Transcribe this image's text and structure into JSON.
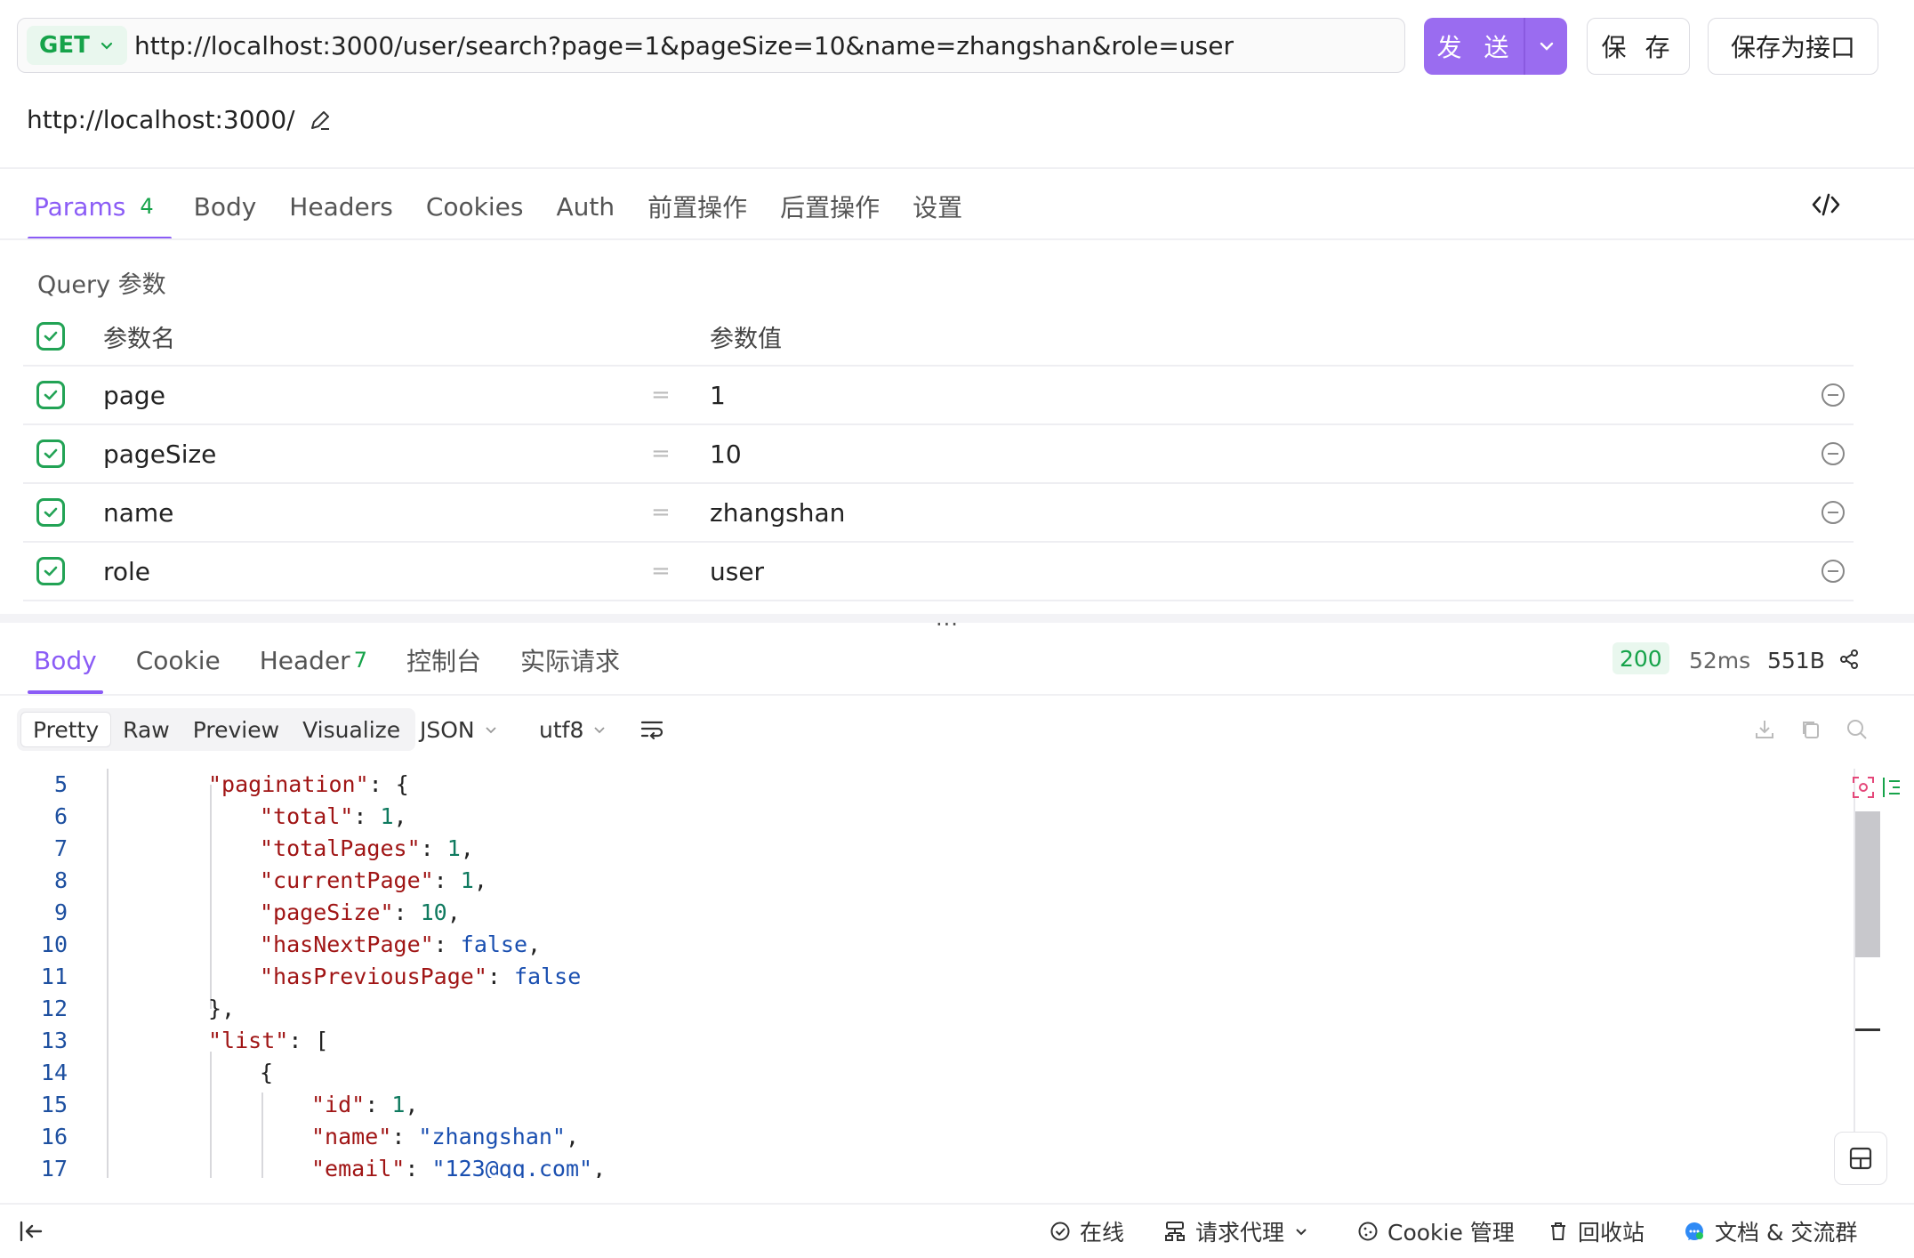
{
  "request": {
    "method": "GET",
    "url": "http://localhost:3000/user/search?page=1&pageSize=10&name=zhangshan&role=user",
    "send_label": "发 送",
    "save_label": "保 存",
    "save_as_label": "保存为接口",
    "base_url": "http://localhost:3000/"
  },
  "tabs": [
    {
      "label": "Params",
      "badge": "4"
    },
    {
      "label": "Body"
    },
    {
      "label": "Headers"
    },
    {
      "label": "Cookies"
    },
    {
      "label": "Auth"
    },
    {
      "label": "前置操作"
    },
    {
      "label": "后置操作"
    },
    {
      "label": "设置"
    }
  ],
  "params": {
    "section_title": "Query 参数",
    "header_name": "参数名",
    "header_value": "参数值",
    "rows": [
      {
        "name": "page",
        "value": "1"
      },
      {
        "name": "pageSize",
        "value": "10"
      },
      {
        "name": "name",
        "value": "zhangshan"
      },
      {
        "name": "role",
        "value": "user"
      }
    ],
    "eq": "="
  },
  "response": {
    "tabs": [
      {
        "label": "Body"
      },
      {
        "label": "Cookie"
      },
      {
        "label": "Header",
        "badge": "7"
      },
      {
        "label": "控制台"
      },
      {
        "label": "实际请求"
      }
    ],
    "status_code": "200",
    "time": "52ms",
    "size": "551B",
    "views": [
      "Pretty",
      "Raw",
      "Preview",
      "Visualize"
    ],
    "format": "JSON",
    "encoding": "utf8",
    "dots": "···"
  },
  "code_lines": [
    {
      "n": "5"
    },
    {
      "n": "6"
    },
    {
      "n": "7"
    },
    {
      "n": "8"
    },
    {
      "n": "9"
    },
    {
      "n": "10"
    },
    {
      "n": "11"
    },
    {
      "n": "12"
    },
    {
      "n": "13"
    },
    {
      "n": "14"
    },
    {
      "n": "15"
    },
    {
      "n": "16"
    },
    {
      "n": "17"
    }
  ],
  "footer": {
    "online": "在线",
    "proxy": "请求代理",
    "cookie_mgmt": "Cookie 管理",
    "recycle": "回收站",
    "docs": "文档 & 交流群"
  },
  "colors": {
    "accent": "#8b5cf6",
    "send": "#9a6cf0",
    "success": "#16a34a"
  }
}
